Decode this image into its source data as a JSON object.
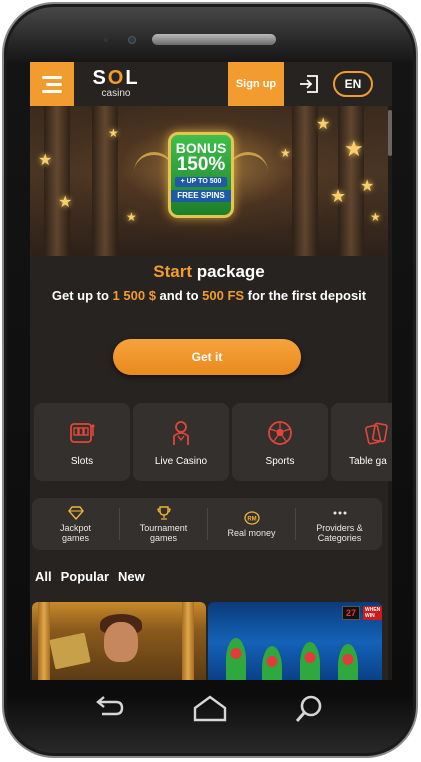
{
  "header": {
    "logo_brand": "SOL",
    "logo_sub": "casino",
    "signup_label": "Sign up",
    "lang_label": "EN"
  },
  "banner": {
    "bonus_line1": "BONUS",
    "bonus_line2": "150%",
    "bonus_line3": "+ UP TO 500",
    "bonus_line4": "FREE SPINS"
  },
  "promo": {
    "title_accent": "Start",
    "title_rest": " package",
    "desc_pre": "Get up to ",
    "desc_amount": "1 500 $",
    "desc_mid": " and to ",
    "desc_fs": "500 FS",
    "desc_post": " for the first deposit",
    "cta_label": "Get it"
  },
  "categories": [
    {
      "label": "Slots",
      "icon": "slot-machine-icon"
    },
    {
      "label": "Live Casino",
      "icon": "dealer-icon"
    },
    {
      "label": "Sports",
      "icon": "soccer-ball-icon"
    },
    {
      "label": "Table ga",
      "icon": "cards-icon"
    }
  ],
  "subnav": [
    {
      "label": "Jackpot games",
      "icon": "diamond-icon"
    },
    {
      "label": "Tournament games",
      "icon": "trophy-icon"
    },
    {
      "label": "Real money",
      "icon": "rm-coin-icon"
    },
    {
      "label": "Providers & Categories",
      "icon": "more-dots-icon"
    }
  ],
  "filters": [
    "All",
    "Popular",
    "New"
  ],
  "games": {
    "game2_badge_num": "27",
    "game2_badge_tag": "WHEN WIN"
  },
  "colors": {
    "accent": "#f29b2e",
    "background": "#262321",
    "card": "#33302d"
  }
}
